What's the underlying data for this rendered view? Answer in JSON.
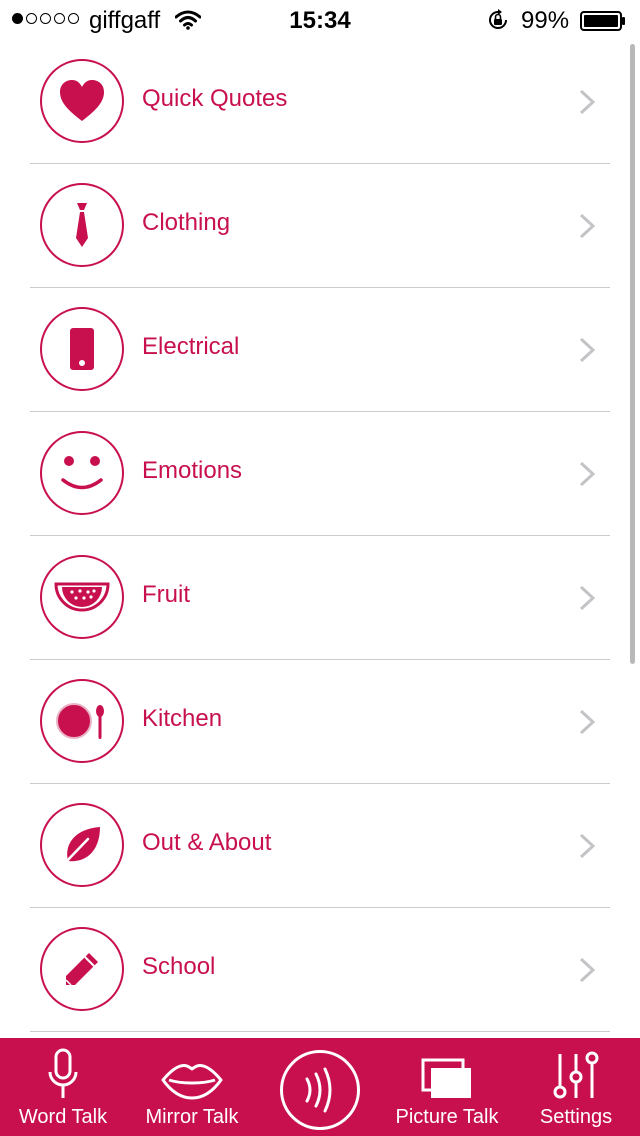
{
  "status_bar": {
    "signal_dots_filled": 1,
    "signal_dots_total": 5,
    "carrier": "giffgaff",
    "time": "15:34",
    "battery_percent": "99%"
  },
  "theme": {
    "accent": "#c8104f",
    "divider": "#cccccc"
  },
  "categories": [
    {
      "label": "Quick Quotes",
      "icon": "heart-icon"
    },
    {
      "label": "Clothing",
      "icon": "tie-icon"
    },
    {
      "label": "Electrical",
      "icon": "phone-icon"
    },
    {
      "label": "Emotions",
      "icon": "smiley-icon"
    },
    {
      "label": "Fruit",
      "icon": "watermelon-icon"
    },
    {
      "label": "Kitchen",
      "icon": "plate-spoon-icon"
    },
    {
      "label": "Out & About",
      "icon": "leaf-icon"
    },
    {
      "label": "School",
      "icon": "pencil-icon"
    }
  ],
  "tab_bar": {
    "tabs": [
      {
        "label": "Word Talk",
        "icon": "microphone-icon"
      },
      {
        "label": "Mirror Talk",
        "icon": "lips-icon"
      },
      {
        "label": "",
        "icon": "speak-waves-icon"
      },
      {
        "label": "Picture Talk",
        "icon": "pictures-icon"
      },
      {
        "label": "Settings",
        "icon": "sliders-icon"
      }
    ]
  }
}
